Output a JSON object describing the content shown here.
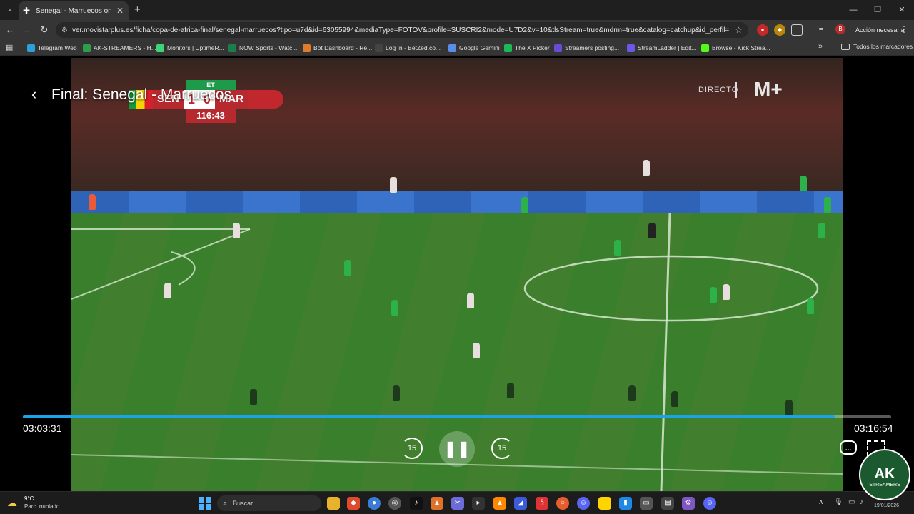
{
  "browser": {
    "tab_title": "Senegal - Marruecos online - M",
    "url": "ver.movistarplus.es/ficha/copa-de-africa-final/senegal-marruecos?tipo=u7d&id=63055994&mediaType=FOTOV&profile=SUSCRI2&mode=U7D2&v=10&tlsStream=true&mdrm=true&catalog=catchup&id_perfil=SUSCRI2...",
    "action_label": "Acción necesaria",
    "profile_initial": "B",
    "bookmarks": [
      {
        "label": "Telegram Web",
        "color": "#2aa1da"
      },
      {
        "label": "AK-STREAMERS - H...",
        "color": "#2e9e4a"
      },
      {
        "label": "Monitors | UptimeR...",
        "color": "#3bd671"
      },
      {
        "label": "NOW Sports - Watc...",
        "color": "#1a7f4b"
      },
      {
        "label": "Bot Dashboard - Re...",
        "color": "#e07b2b"
      },
      {
        "label": "Log In - BetZed.co...",
        "color": "#444444"
      },
      {
        "label": "Google Gemini",
        "color": "#5a8de8"
      },
      {
        "label": "The X Picker",
        "color": "#1db954"
      },
      {
        "label": "Streamers posting...",
        "color": "#6a4bd6"
      },
      {
        "label": "StreamLadder | Edit...",
        "color": "#6b58e6"
      },
      {
        "label": "Browse - Kick Strea...",
        "color": "#53fc18"
      }
    ],
    "all_bookmarks_label": "Todos los marcadores"
  },
  "player": {
    "title": "Final: Senegal - Marruecos",
    "live_label": "DIRECTO",
    "channel_logo": "M+",
    "current_time": "03:03:31",
    "total_time": "03:16:54",
    "progress": 0.935,
    "skip_back_label": "15",
    "skip_forward_label": "15",
    "pause_icon": "❚❚"
  },
  "scoreboard": {
    "period": "ET",
    "home": "SEN",
    "away": "MAR",
    "home_score": "1",
    "away_score": "0",
    "clock": "116:43"
  },
  "overlay_logo": {
    "name": "AK",
    "sub": "STREAMERS"
  },
  "taskbar": {
    "temperature": "9°C",
    "condition": "Parc. nublado",
    "search_placeholder": "Buscar",
    "date": "19/01/2026"
  }
}
